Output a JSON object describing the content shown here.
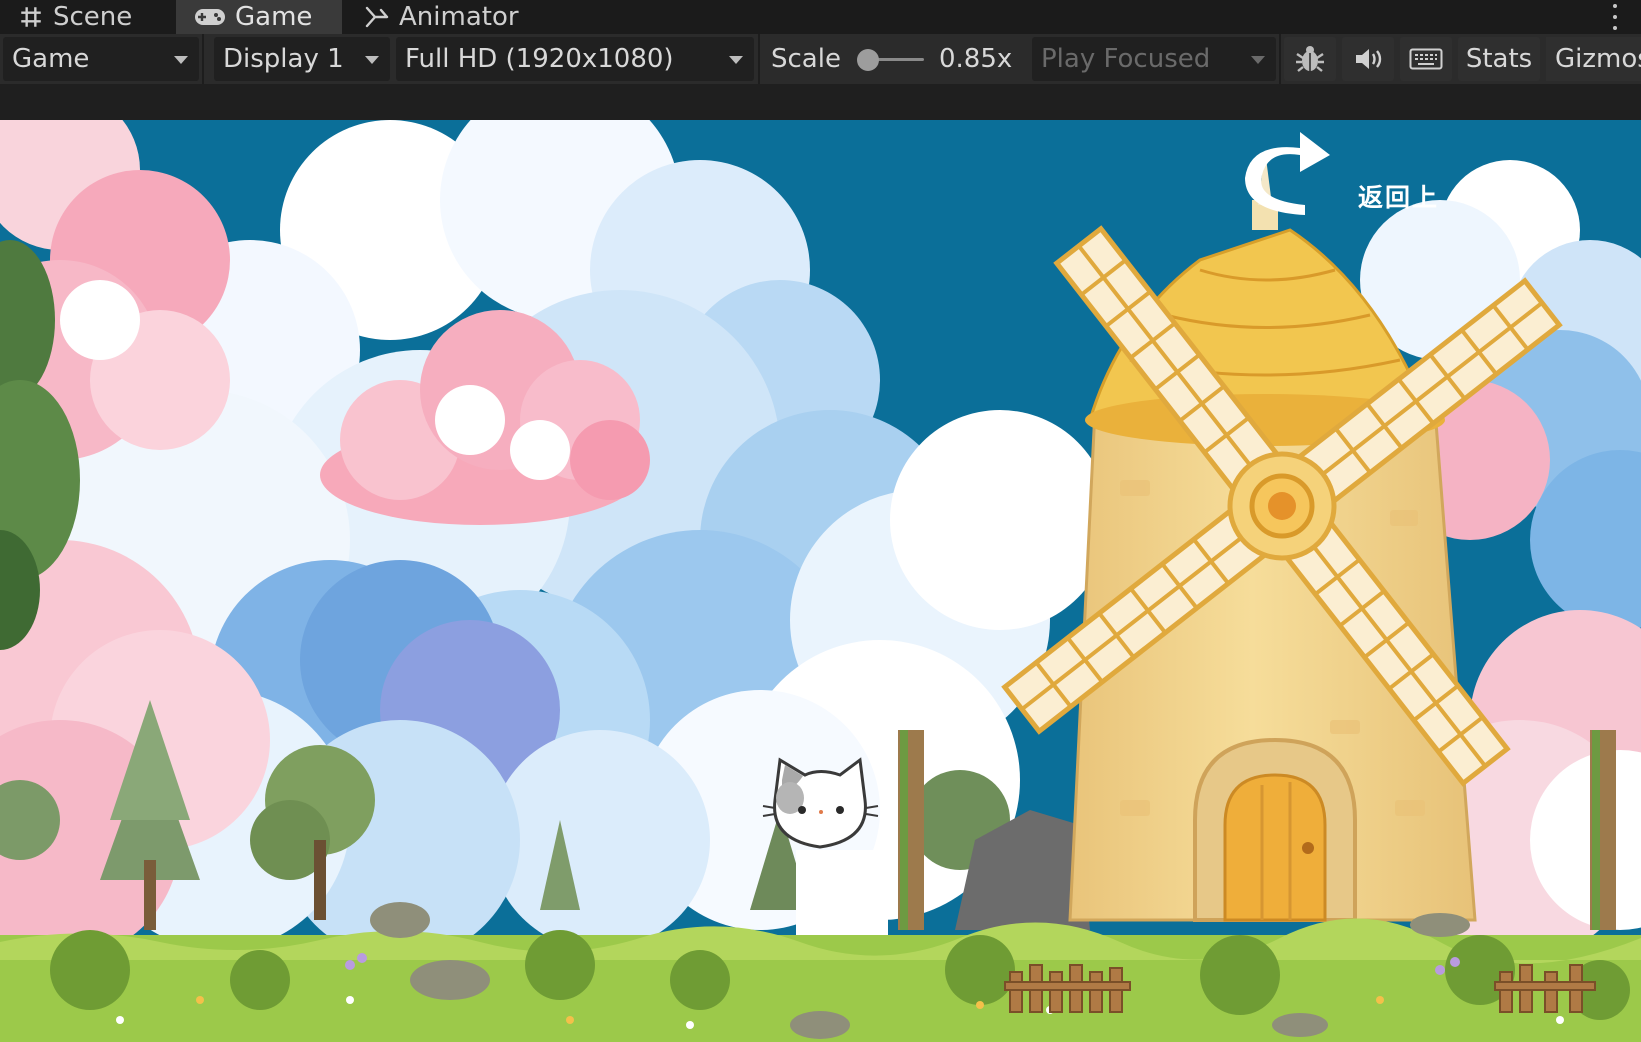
{
  "tabs": [
    {
      "label": "Scene",
      "icon": "grid-hash-icon",
      "active": false
    },
    {
      "label": "Game",
      "icon": "gamepad-icon",
      "active": true
    },
    {
      "label": "Animator",
      "icon": "animator-icon",
      "active": false
    }
  ],
  "toolbar": {
    "view_dropdown": "Game",
    "display_dropdown": "Display 1",
    "resolution_dropdown": "Full HD (1920x1080)",
    "scale_label": "Scale",
    "scale_value": "0.85x",
    "play_mode_dropdown": "Play Focused",
    "stats_label": "Stats",
    "gizmos_label": "Gizmos"
  },
  "game": {
    "back_label": "返回上"
  },
  "colors": {
    "sky": "#0b6f99",
    "grass": "#9cc94a",
    "windmill_wall": "#f3d68c",
    "windmill_roof": "#f2c64f",
    "cloud_pink": "#f7b6c4",
    "cloud_blue": "#8ec4ea"
  }
}
